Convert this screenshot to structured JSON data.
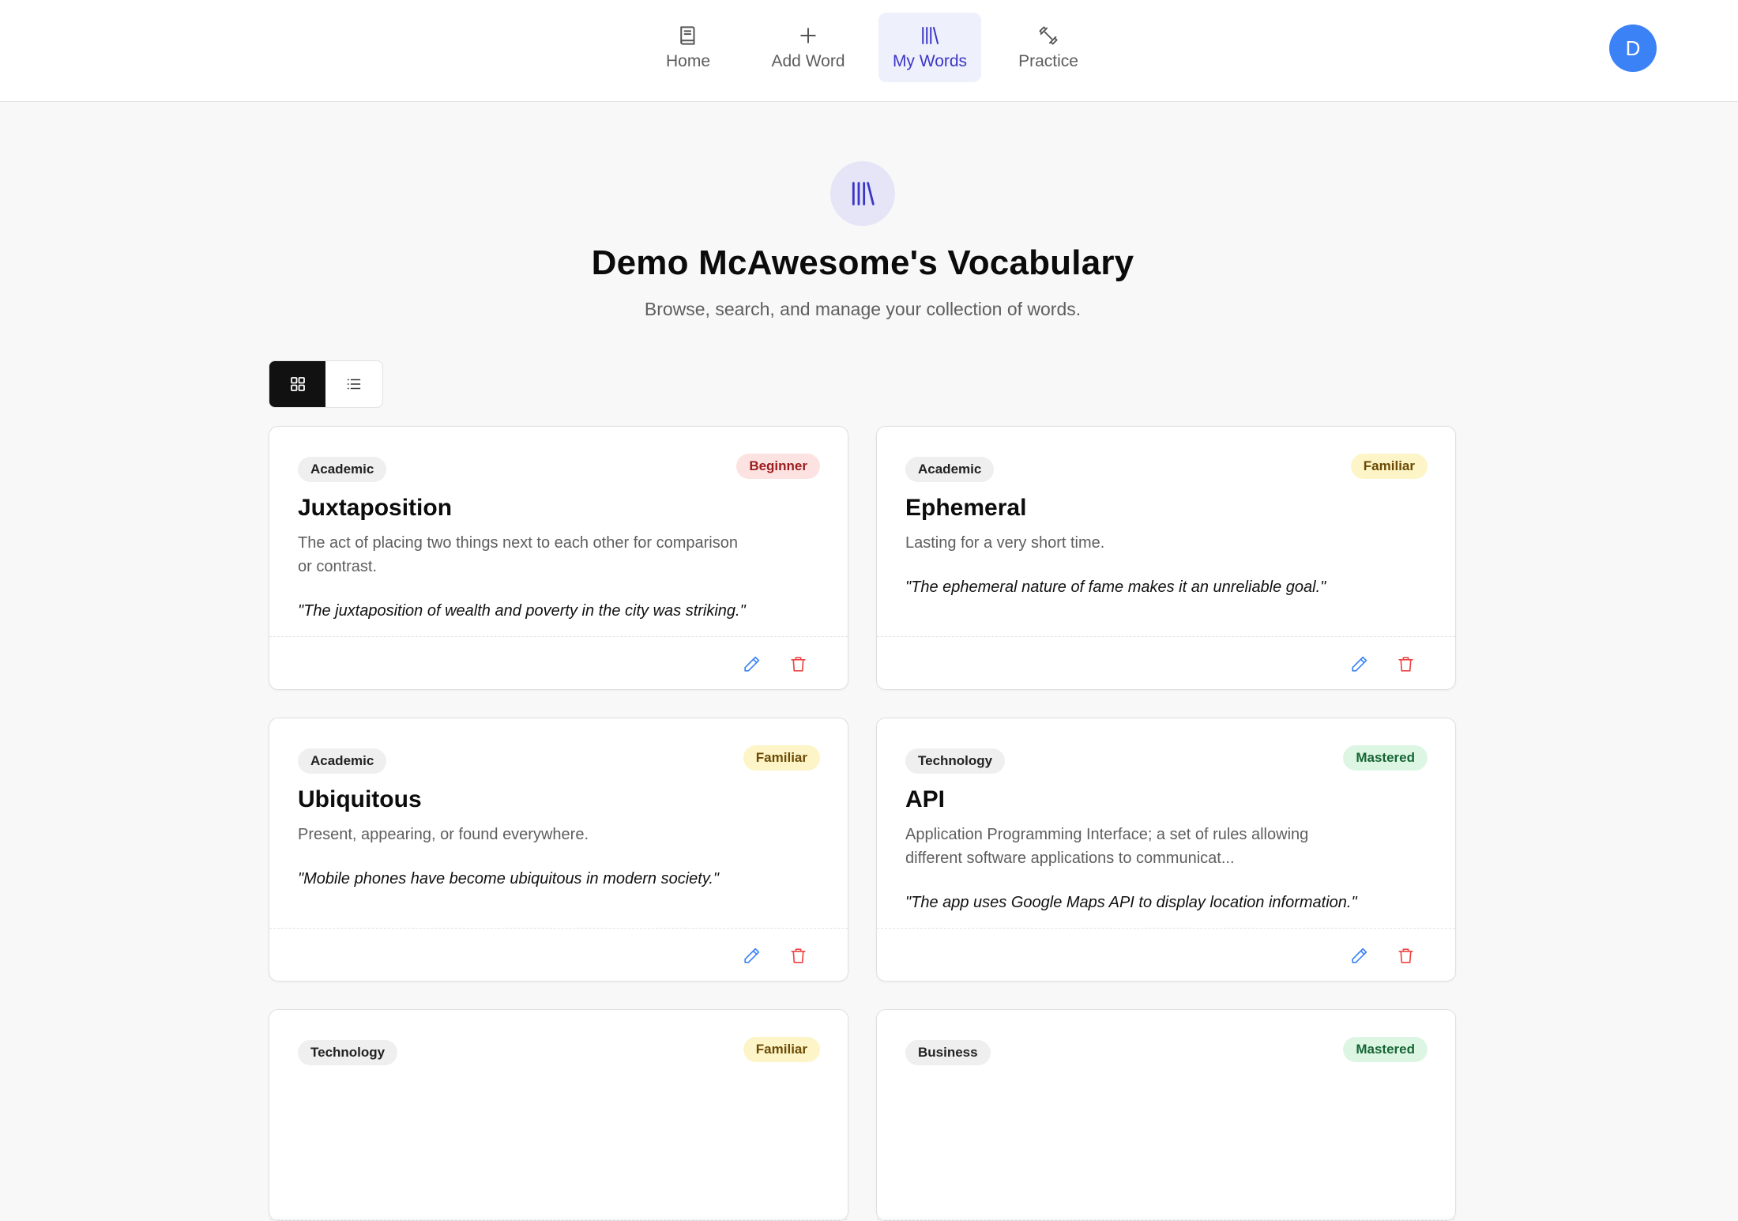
{
  "nav": {
    "items": [
      {
        "label": "Home",
        "icon": "book-icon"
      },
      {
        "label": "Add Word",
        "icon": "plus-icon"
      },
      {
        "label": "My Words",
        "icon": "library-icon",
        "active": true
      },
      {
        "label": "Practice",
        "icon": "dumbbell-icon"
      }
    ],
    "avatar_initial": "D"
  },
  "header": {
    "title": "Demo McAwesome's Vocabulary",
    "subtitle": "Browse, search, and manage your collection of words."
  },
  "view_toggle": {
    "selected": "grid",
    "options": [
      "grid-icon",
      "list-icon"
    ]
  },
  "colors": {
    "accent": "#3b37c6",
    "avatar": "#3b82f6",
    "beginner": "#fde2e2",
    "familiar": "#fdf5c7",
    "mastered": "#ddf6e4",
    "edit": "#3b82f6",
    "delete": "#ef4444"
  },
  "cards": [
    {
      "category": "Academic",
      "level": "Beginner",
      "word": "Juxtaposition",
      "definition": "The act of placing two things next to each other for comparison or contrast.",
      "example": "\"The juxtaposition of wealth and poverty in the city was striking.\""
    },
    {
      "category": "Academic",
      "level": "Familiar",
      "word": "Ephemeral",
      "definition": "Lasting for a very short time.",
      "example": "\"The ephemeral nature of fame makes it an unreliable goal.\""
    },
    {
      "category": "Academic",
      "level": "Familiar",
      "word": "Ubiquitous",
      "definition": "Present, appearing, or found everywhere.",
      "example": "\"Mobile phones have become ubiquitous in modern society.\""
    },
    {
      "category": "Technology",
      "level": "Mastered",
      "word": "API",
      "definition": "Application Programming Interface; a set of rules allowing different software applications to communicat...",
      "example": "\"The app uses Google Maps API to display location information.\""
    },
    {
      "category": "Technology",
      "level": "Familiar"
    },
    {
      "category": "Business",
      "level": "Mastered"
    }
  ]
}
